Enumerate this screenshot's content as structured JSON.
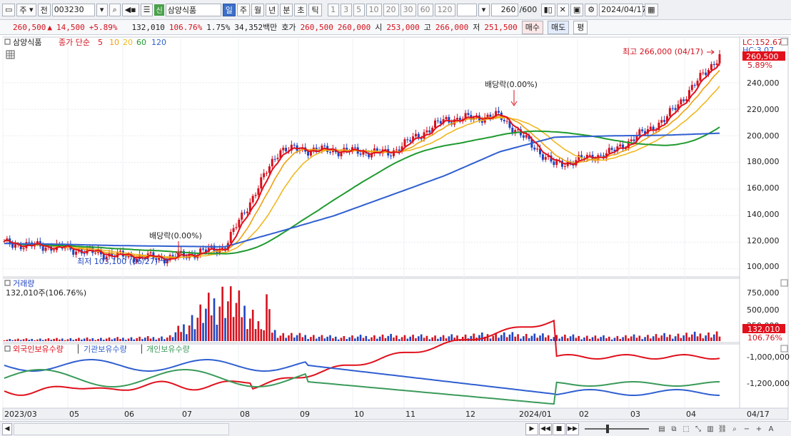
{
  "toolbar": {
    "market": "주",
    "prev": "전",
    "code": "003230",
    "new_badge": "신",
    "stock_name": "삼양식품",
    "periods": [
      "일",
      "주",
      "월",
      "년",
      "분",
      "초",
      "틱"
    ],
    "active_period": "일",
    "numbers": [
      "1",
      "3",
      "5",
      "10",
      "20",
      "30",
      "60",
      "120"
    ],
    "count": "260",
    "count_total": "/600",
    "date": "2024/04/17"
  },
  "quote": {
    "price": "260,500",
    "arrow": "▲",
    "change": "14,500",
    "change_pct": "+5.89%",
    "volume": "132,010",
    "volume_ratio": "106.76%",
    "turnover": "1.75%",
    "amount": "34,352백만",
    "ask_label": "호가",
    "ask1": "260,500",
    "ask2": "260,000",
    "open_label": "시",
    "open": "253,000",
    "high_label": "고",
    "high": "266,000",
    "low_label": "저",
    "low": "251,500",
    "buy_label": "매수",
    "sell_label": "매도",
    "eval_label": "평"
  },
  "price_panel": {
    "stock": "삼양식품",
    "ma_label": "종가 단순",
    "ma_periods": [
      "5",
      "10",
      "20",
      "60",
      "120"
    ],
    "lc": "LC:152.67",
    "hc": "HC:3.07",
    "current_price": "260,500",
    "current_pct": "5.89%",
    "high_note": "최고 266,000 (04/17)",
    "low_note": "최저 103,100 (06/27)",
    "dividend_note": "배당락(0.00%)",
    "y_labels": [
      "240,000",
      "220,000",
      "200,000",
      "180,000",
      "160,000",
      "140,000",
      "120,000",
      "100,000"
    ]
  },
  "volume_panel": {
    "title": "거래량",
    "info": "132,010주(106.76%)",
    "y_labels": [
      "750,000",
      "500,000",
      "250,000"
    ],
    "current": "132,010",
    "current_pct": "106.76%"
  },
  "holding_panel": {
    "legend": [
      "외국인보유수량",
      "기관보유수량",
      "개인보유수량"
    ],
    "y_labels": [
      "-1,000,000",
      "-1,200,000"
    ]
  },
  "x_axis": [
    "2023/03",
    "05",
    "06",
    "07",
    "08",
    "09",
    "10",
    "11",
    "12",
    "2024/01",
    "02",
    "03",
    "04",
    "04/17"
  ],
  "colors": {
    "ma5": "#e0101c",
    "ma10": "#f0a010",
    "ma20": "#f0b820",
    "ma60": "#1f9a2f",
    "ma120": "#2f5fd0",
    "up": "#d4121e",
    "down": "#1f45c0",
    "foreign": "#e0101c",
    "institution": "#2f5fd0",
    "individual": "#3a9a5a"
  },
  "chart_data": [
    {
      "type": "line",
      "title": "삼양식품 종가 단순",
      "x": [
        "2023/03",
        "05",
        "06",
        "07",
        "08",
        "09",
        "10",
        "11",
        "12",
        "2024/01",
        "02",
        "03",
        "04",
        "04/17"
      ],
      "series": [
        {
          "name": "종가",
          "values": [
            119000,
            116000,
            110000,
            108000,
            116000,
            190000,
            189000,
            187000,
            212000,
            215000,
            178000,
            187000,
            212000,
            260500
          ]
        },
        {
          "name": "120",
          "values": [
            119000,
            118500,
            117500,
            117000,
            116500,
            128000,
            140000,
            155000,
            170000,
            188000,
            199000,
            200000,
            200500,
            202000
          ]
        },
        {
          "name": "60",
          "values": [
            119000,
            118000,
            115000,
            113000,
            114000,
            150000,
            175000,
            192000,
            203000,
            208000,
            204000,
            197000,
            193000,
            196000
          ]
        }
      ],
      "ylim": [
        95000,
        270000
      ]
    },
    {
      "type": "bar",
      "title": "거래량",
      "x": [
        "2023/03",
        "05",
        "06",
        "07",
        "08",
        "09",
        "10",
        "11",
        "12",
        "2024/01",
        "02",
        "03",
        "04",
        "04/17"
      ],
      "values": [
        30000,
        40000,
        50000,
        70000,
        820000,
        120000,
        70000,
        90000,
        80000,
        120000,
        90000,
        70000,
        100000,
        132010
      ],
      "ylim": [
        0,
        850000
      ]
    }
  ]
}
